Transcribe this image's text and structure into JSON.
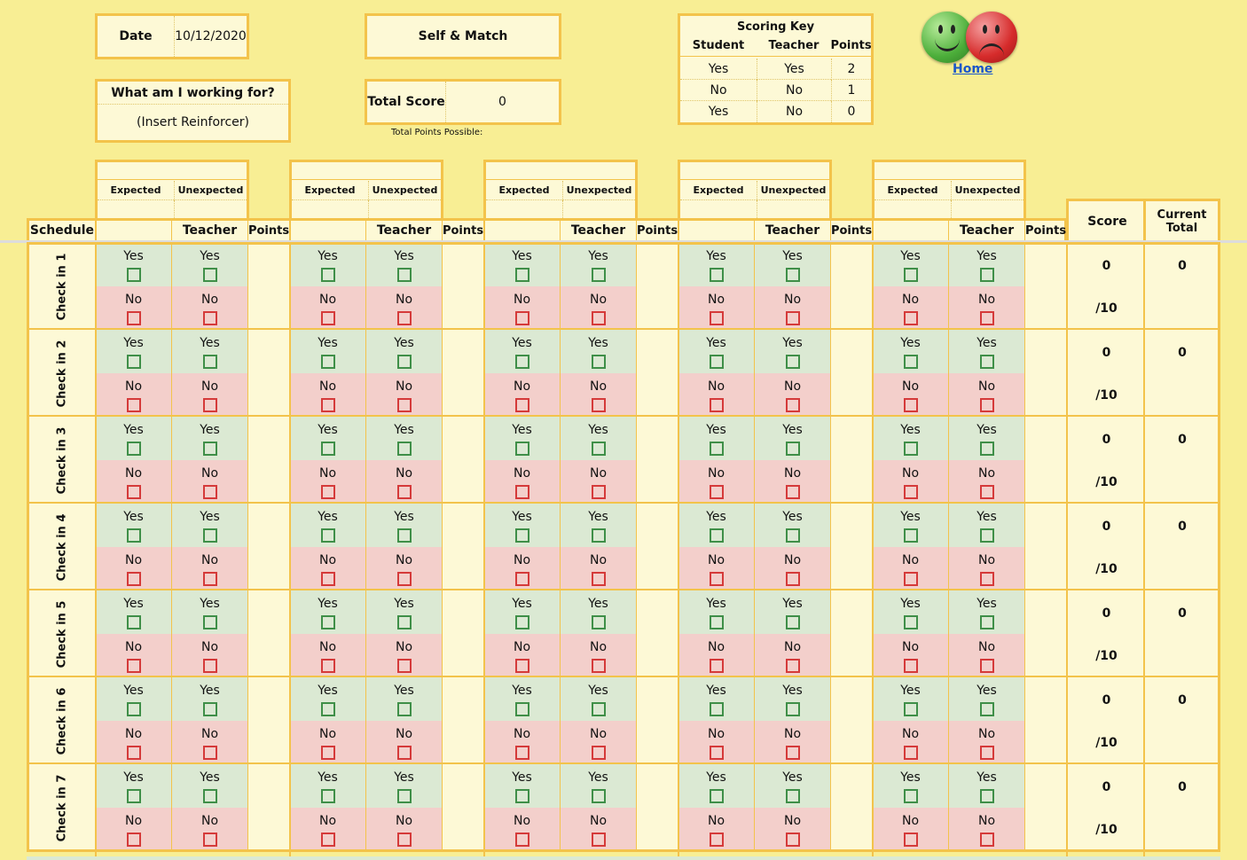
{
  "header": {
    "date_label": "Date",
    "date_value": "10/12/2020",
    "mode_label": "Self & Match",
    "working_for_label": "What am I working for?",
    "reinforcer": "(Insert Reinforcer)",
    "total_score_label": "Total Score",
    "total_score_value": "0",
    "total_points_possible_label": "Total Points Possible:"
  },
  "scoring_key": {
    "title": "Scoring Key",
    "columns": [
      "Student",
      "Teacher",
      "Points"
    ],
    "rows": [
      [
        "Yes",
        "Yes",
        "2"
      ],
      [
        "No",
        "No",
        "1"
      ],
      [
        "Yes",
        "No",
        "0"
      ]
    ]
  },
  "home_link": "Home",
  "columns": {
    "schedule": "Schedule",
    "expected": "Expected",
    "unexpected": "Unexpected",
    "teacher": "Teacher",
    "points": "Points",
    "score": "Score",
    "current_total": "Current Total",
    "yes": "Yes",
    "no": "No"
  },
  "checkins": [
    {
      "label": "Check in 1",
      "score": "0",
      "out_of": "/10",
      "total": "0"
    },
    {
      "label": "Check in 2",
      "score": "0",
      "out_of": "/10",
      "total": "0"
    },
    {
      "label": "Check in 3",
      "score": "0",
      "out_of": "/10",
      "total": "0"
    },
    {
      "label": "Check in 4",
      "score": "0",
      "out_of": "/10",
      "total": "0"
    },
    {
      "label": "Check in 5",
      "score": "0",
      "out_of": "/10",
      "total": "0"
    },
    {
      "label": "Check in 6",
      "score": "0",
      "out_of": "/10",
      "total": "0"
    },
    {
      "label": "Check in 7",
      "score": "0",
      "out_of": "/10",
      "total": "0"
    }
  ],
  "colors": {
    "background": "#f8ee94",
    "border": "#f3c34b",
    "yes_fill": "#dbe9d3",
    "no_fill": "#f3cfcb",
    "yes_checkbox": "#3f8f48",
    "no_checkbox": "#d53a3a"
  }
}
